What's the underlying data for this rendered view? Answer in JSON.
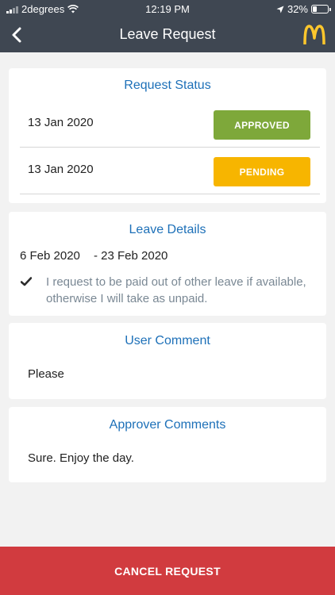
{
  "status_bar": {
    "carrier": "2degrees",
    "time": "12:19 PM",
    "battery_percent": "32%",
    "battery_level": 0.32
  },
  "nav": {
    "title": "Leave Request",
    "back_icon": "chevron-left-icon",
    "logo_icon": "golden-arches-logo"
  },
  "request_status": {
    "title": "Request Status",
    "rows": [
      {
        "date": "13 Jan 2020",
        "status": "APPROVED",
        "color": "#7ea83a"
      },
      {
        "date": "13 Jan 2020",
        "status": "PENDING",
        "color": "#f7b500"
      }
    ]
  },
  "leave_details": {
    "title": "Leave Details",
    "start": "6 Feb 2020",
    "end": "- 23 Feb 2020",
    "note": "I request to be paid out of other leave if available, otherwise I will take as unpaid."
  },
  "user_comment": {
    "title": "User Comment",
    "text": "Please"
  },
  "approver_comments": {
    "title": "Approver Comments",
    "text": "Sure. Enjoy the day."
  },
  "footer": {
    "cancel_label": "CANCEL REQUEST",
    "color": "#d13b3f"
  },
  "colors": {
    "header": "#3f4752",
    "accent": "#1d70b8",
    "background": "#f2f2f2"
  }
}
